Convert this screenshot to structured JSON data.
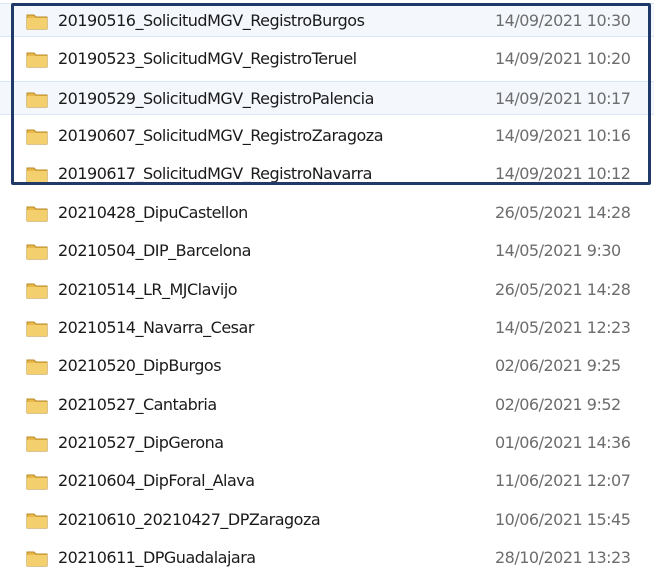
{
  "files": [
    {
      "name": "20190516_SolicitudMGV_RegistroBurgos",
      "date": "14/09/2021 10:30",
      "icon": "folder-icon"
    },
    {
      "name": "20190523_SolicitudMGV_RegistroTeruel",
      "date": "14/09/2021 10:20",
      "icon": "folder-icon"
    },
    {
      "name": "20190529_SolicitudMGV_RegistroPalencia",
      "date": "14/09/2021 10:17",
      "icon": "folder-icon"
    },
    {
      "name": "20190607_SolicitudMGV_RegistroZaragoza",
      "date": "14/09/2021 10:16",
      "icon": "folder-icon"
    },
    {
      "name": "20190617_SolicitudMGV_RegistroNavarra",
      "date": "14/09/2021 10:12",
      "icon": "folder-icon"
    },
    {
      "name": "20210428_DipuCastellon",
      "date": "26/05/2021 14:28",
      "icon": "folder-icon"
    },
    {
      "name": "20210504_DIP_Barcelona",
      "date": "14/05/2021 9:30",
      "icon": "folder-icon"
    },
    {
      "name": "20210514_LR_MJClavijo",
      "date": "26/05/2021 14:28",
      "icon": "folder-icon"
    },
    {
      "name": "20210514_Navarra_Cesar",
      "date": "14/05/2021 12:23",
      "icon": "folder-icon"
    },
    {
      "name": "20210520_DipBurgos",
      "date": "02/06/2021 9:25",
      "icon": "folder-icon"
    },
    {
      "name": "20210527_Cantabria",
      "date": "02/06/2021 9:52",
      "icon": "folder-icon"
    },
    {
      "name": "20210527_DipGerona",
      "date": "01/06/2021 14:36",
      "icon": "folder-icon"
    },
    {
      "name": "20210604_DipForal_Alava",
      "date": "11/06/2021 12:07",
      "icon": "folder-icon"
    },
    {
      "name": "20210610_20210427_DPZaragoza",
      "date": "10/06/2021 15:45",
      "icon": "folder-icon"
    },
    {
      "name": "20210611_DPGuadalajara",
      "date": "28/10/2021 13:23",
      "icon": "folder-icon"
    }
  ],
  "colors": {
    "selection_border": "#1f3a68",
    "hover_background": "#f4f8fd",
    "date_text": "#6d6d6d",
    "name_text": "#1a1a1a"
  }
}
